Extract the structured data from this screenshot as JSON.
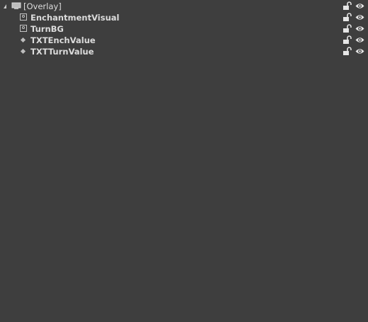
{
  "hierarchy": {
    "root": {
      "label": "[Overlay]",
      "icon": "overlay-icon"
    },
    "children": [
      {
        "label": "EnchantmentVisual",
        "icon": "image-icon"
      },
      {
        "label": "TurnBG",
        "icon": "image-icon"
      },
      {
        "label": "TXTEnchValue",
        "icon": "text-diamond-icon"
      },
      {
        "label": "TXTTurnValue",
        "icon": "text-diamond-icon"
      }
    ]
  },
  "colors": {
    "background": "#3e3e3e",
    "text": "#dcdcdc",
    "icon": "#d8d8d8"
  }
}
